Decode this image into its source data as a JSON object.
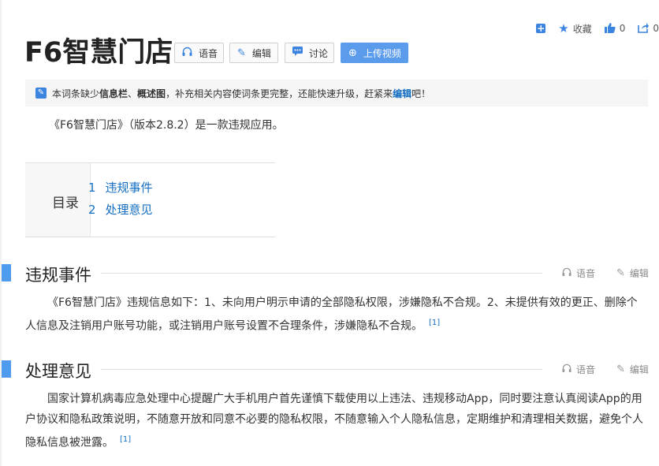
{
  "toolbar": {
    "add_label": "+",
    "favorite_label": "收藏",
    "like_count": "0",
    "share_count": "0"
  },
  "title": "F6智慧门店",
  "buttons": {
    "voice": "语音",
    "edit": "编辑",
    "discuss": "讨论",
    "upload": "上传视频"
  },
  "notice": {
    "prefix": "本词条缺少",
    "item1": "信息栏",
    "sep": "、",
    "item2": "概述图",
    "middle": "，补充相关内容使词条更完整，还能快速升级，赶紧来",
    "link": "编辑",
    "suffix": "吧！"
  },
  "summary": "《F6智慧门店》（版本2.8.2）是一款违规应用。",
  "catalog": {
    "title": "目录",
    "items": [
      {
        "num": "1",
        "label": "违规事件"
      },
      {
        "num": "2",
        "label": "处理意见"
      }
    ]
  },
  "sections": [
    {
      "title": "违规事件",
      "voice": "语音",
      "edit": "编辑",
      "text": "《F6智慧门店》违规信息如下：1、未向用户明示申请的全部隐私权限，涉嫌隐私不合规。2、未提供有效的更正、删除个人信息及注销用户账号功能，或注销用户账号设置不合理条件，涉嫌隐私不合规。",
      "ref": "[1]"
    },
    {
      "title": "处理意见",
      "voice": "语音",
      "edit": "编辑",
      "text": "国家计算机病毒应急处理中心提醒广大手机用户首先谨慎下载使用以上违法、违规移动App，同时要注意认真阅读App的用户协议和隐私政策说明，不随意开放和同意不必要的隐私权限，不随意输入个人隐私信息，定期维护和清理相关数据，避免个人隐私信息被泄露。",
      "ref": "[1]"
    }
  ],
  "colors": {
    "accent": "#3b84e0",
    "link": "#136ec2",
    "section_bar": "#4f9cee",
    "upload_button": "#5b9bec"
  }
}
